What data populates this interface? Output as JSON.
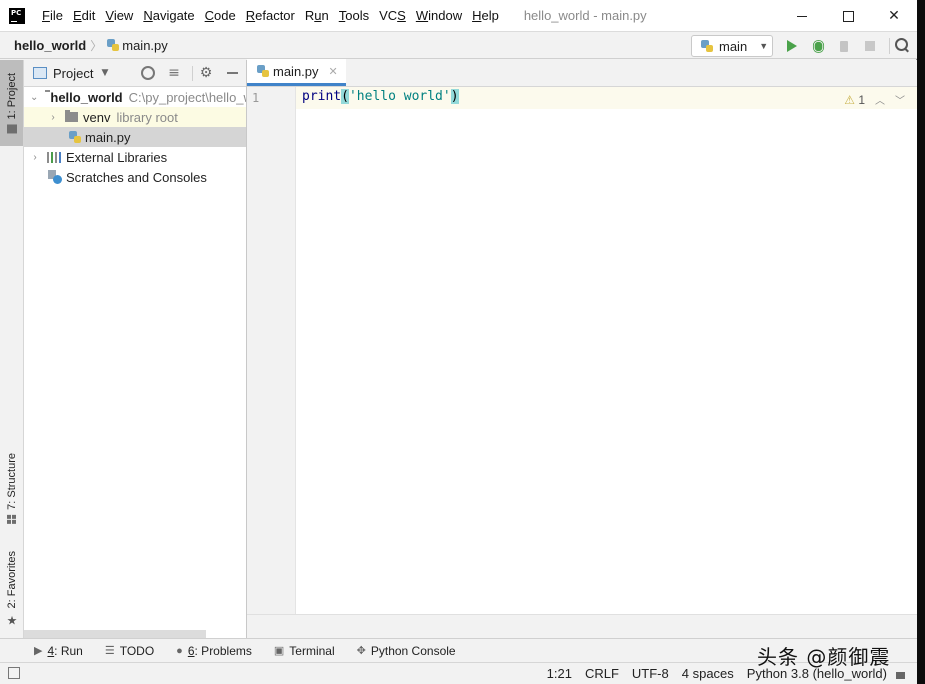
{
  "window": {
    "title": "hello_world - main.py",
    "menu": [
      {
        "pre": "",
        "u": "F",
        "post": "ile"
      },
      {
        "pre": "",
        "u": "E",
        "post": "dit"
      },
      {
        "pre": "",
        "u": "V",
        "post": "iew"
      },
      {
        "pre": "",
        "u": "N",
        "post": "avigate"
      },
      {
        "pre": "",
        "u": "C",
        "post": "ode"
      },
      {
        "pre": "",
        "u": "R",
        "post": "efactor"
      },
      {
        "pre": "R",
        "u": "u",
        "post": "n"
      },
      {
        "pre": "",
        "u": "T",
        "post": "ools"
      },
      {
        "pre": "VC",
        "u": "S",
        "post": ""
      },
      {
        "pre": "",
        "u": "W",
        "post": "indow"
      },
      {
        "pre": "",
        "u": "H",
        "post": "elp"
      }
    ],
    "app_logo": "PC"
  },
  "navbar": {
    "project": "hello_world",
    "file": "main.py",
    "run_config": "main"
  },
  "left_stripe": {
    "project": "1: Project",
    "structure": "7: Structure",
    "favorites": "2: Favorites"
  },
  "project_panel": {
    "title": "Project",
    "tree": {
      "root_name": "hello_world",
      "root_path": "C:\\py_project\\hello_world",
      "venv_name": "venv",
      "venv_note": "library root",
      "main_file": "main.py",
      "external": "External Libraries",
      "scratches": "Scratches and Consoles"
    }
  },
  "editor": {
    "tab": "main.py",
    "line_number": "1",
    "code": {
      "fn": "print",
      "open": "(",
      "str": "'hello world'",
      "close": ")"
    },
    "warnings": "1"
  },
  "bottom_tabs": [
    {
      "num": "4",
      "label": ": Run"
    },
    {
      "num": "",
      "label": "TODO"
    },
    {
      "num": "6",
      "label": ": Problems"
    },
    {
      "num": "",
      "label": "Terminal"
    },
    {
      "num": "",
      "label": "Python Console"
    }
  ],
  "status": {
    "position": "1:21",
    "line_sep": "CRLF",
    "encoding": "UTF-8",
    "indent": "4 spaces",
    "interpreter": "Python 3.8 (hello_world)"
  },
  "watermark": "头条 @颜御震"
}
